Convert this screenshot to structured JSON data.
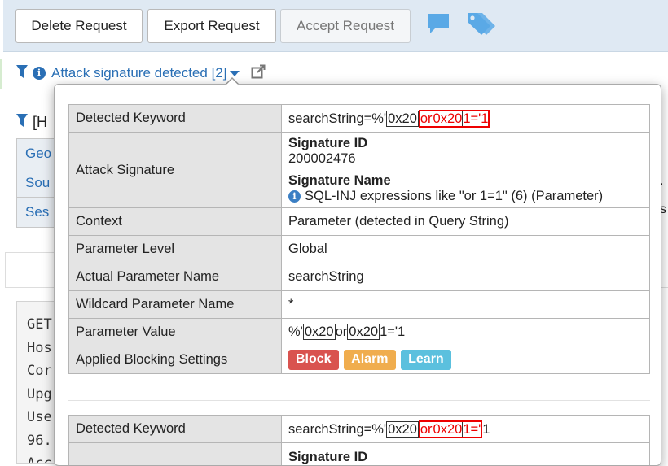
{
  "toolbar": {
    "delete_label": "Delete Request",
    "export_label": "Export Request",
    "accept_label": "Accept Request",
    "comment_icon": "comment-icon",
    "tags_icon": "tags-icon"
  },
  "filter": {
    "violation_label": "Attack signature detected [2]",
    "second_filter_fragment": "[H"
  },
  "background": {
    "table_cells": [
      "Geo",
      "Sou",
      "Ses"
    ],
    "right_fragments": [
      ".",
      "s"
    ],
    "code_lines": [
      "GET",
      "Hos",
      "Cor",
      "Upg",
      "Use",
      "96.",
      "Acc"
    ]
  },
  "details": [
    {
      "detected_keyword_label": "Detected Keyword",
      "detected_keyword": {
        "prefix": "searchString=%'",
        "p1": "0x20",
        "p2": "or",
        "p3": "0x20",
        "p4": "1='1",
        "suffix": ""
      },
      "attack_signature_label": "Attack Signature",
      "signature_id_label": "Signature ID",
      "signature_id": "200002476",
      "signature_name_label": "Signature Name",
      "signature_name": "SQL-INJ expressions like \"or 1=1\" (6) (Parameter)",
      "context_label": "Context",
      "context": "Parameter (detected in Query String)",
      "parameter_level_label": "Parameter Level",
      "parameter_level": "Global",
      "actual_parameter_name_label": "Actual Parameter Name",
      "actual_parameter_name": "searchString",
      "wildcard_parameter_name_label": "Wildcard Parameter Name",
      "wildcard_parameter_name": "*",
      "parameter_value_label": "Parameter Value",
      "parameter_value": {
        "p0": "%'",
        "p1": "0x20",
        "p2": "or",
        "p3": "0x20",
        "p4": "1='1"
      },
      "blocking_settings_label": "Applied Blocking Settings",
      "blocking_settings": [
        "Block",
        "Alarm",
        "Learn"
      ]
    },
    {
      "detected_keyword_label": "Detected Keyword",
      "detected_keyword": {
        "prefix": "searchString=%'",
        "p1": "0x20",
        "p2": "or",
        "p3": "0x20",
        "p4": "1='",
        "suffix": "1"
      },
      "signature_id_label": "Signature ID"
    }
  ],
  "colors": {
    "block": "#d9534f",
    "alarm": "#f0ad4e",
    "learn": "#5bc0de",
    "link": "#2a6fb5",
    "highlight_red": "#e00000"
  }
}
